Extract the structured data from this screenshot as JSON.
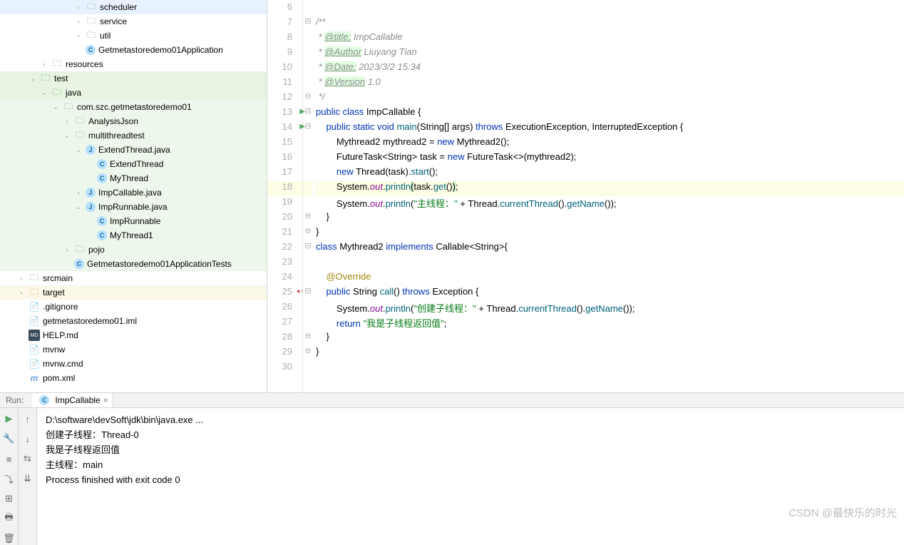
{
  "tree": {
    "scheduler": "scheduler",
    "service": "service",
    "util": "util",
    "app": "Getmetastoredemo01Application",
    "resources": "resources",
    "test": "test",
    "java": "java",
    "pkg": "com.szc.getmetastoredemo01",
    "analysisJson": "AnalysisJson",
    "multithreadtest": "multithreadtest",
    "extendThreadJava": "ExtendThread.java",
    "extendThread": "ExtendThread",
    "myThread": "MyThread",
    "impCallableJava": "ImpCallable.java",
    "impRunnableJava": "ImpRunnable.java",
    "impRunnable": "ImpRunnable",
    "myThread1": "MyThread1",
    "pojo": "pojo",
    "appTests": "Getmetastoredemo01ApplicationTests",
    "srcmain": "srcmain",
    "target": "target",
    "gitignore": ".gitignore",
    "iml": "getmetastoredemo01.iml",
    "helpMd": "HELP.md",
    "mvnw": "mvnw",
    "mvnwCmd": "mvnw.cmd",
    "pomXml": "pom.xml"
  },
  "gutter": [
    "6",
    "7",
    "8",
    "9",
    "10",
    "11",
    "12",
    "13",
    "14",
    "15",
    "16",
    "17",
    "18",
    "19",
    "20",
    "21",
    "22",
    "23",
    "24",
    "25",
    "26",
    "27",
    "28",
    "29",
    "30"
  ],
  "code": {
    "l7": "/**",
    "l8a": " * ",
    "l8b": "@title:",
    "l8c": " ImpCallable",
    "l9a": " * ",
    "l9b": "@Author",
    "l9c": " Liuyang Tian",
    "l10a": " * ",
    "l10b": "@Date:",
    "l10c": " 2023/3/2 15:34",
    "l11a": " * ",
    "l11b": "@Version",
    "l11c": " 1.0",
    "l12": " */",
    "l13_pub": "public ",
    "l13_class": "class ",
    "l13_name": "ImpCallable {",
    "l14_pub": "public ",
    "l14_static": "static ",
    "l14_void": "void ",
    "l14_main": "main",
    "l14_args": "(String[] args) ",
    "l14_throws": "throws ",
    "l14_exc": "ExecutionException, InterruptedException {",
    "l15a": "Mythread2 mythread2 = ",
    "l15_new": "new ",
    "l15b": "Mythread2();",
    "l16a": "FutureTask<String> task = ",
    "l16_new": "new ",
    "l16b": "FutureTask<>(mythread2);",
    "l17_new": "new ",
    "l17a": "Thread(task).",
    "l17_start": "start",
    "l17b": "();",
    "l18a": "System.",
    "l18_out": "out",
    "l18b": ".",
    "l18_println": "println",
    "l18_lp": "(",
    "l18c": "task.",
    "l18_get": "get",
    "l18d": "()",
    "l18_rp": ")",
    "l18e": ";",
    "l19a": "System.",
    "l19_out": "out",
    "l19b": ".",
    "l19_println": "println",
    "l19c": "(",
    "l19_str": "\"主线程：\"",
    "l19d": " + Thread.",
    "l19_ct": "currentThread",
    "l19e": "().",
    "l19_gn": "getName",
    "l19f": "());",
    "l20": "}",
    "l21": "}",
    "l22_class": "class ",
    "l22_name": "Mythread2 ",
    "l22_impl": "implements ",
    "l22_call": "Callable<String>{",
    "l24": "@Override",
    "l25_pub": "public ",
    "l25_str": "String ",
    "l25_call": "call",
    "l25a": "() ",
    "l25_throws": "throws ",
    "l25b": "Exception {",
    "l26a": "System.",
    "l26_out": "out",
    "l26b": ".",
    "l26_println": "println",
    "l26c": "(",
    "l26_str": "\"创建子线程：\"",
    "l26d": " + Thread.",
    "l26_ct": "currentThread",
    "l26e": "().",
    "l26_gn": "getName",
    "l26f": "());",
    "l27_ret": "return ",
    "l27_str": "\"我是子线程返回值\"",
    "l27a": ";",
    "l28": "}",
    "l29": "}"
  },
  "run": {
    "headerLabel": "Run:",
    "tabName": "ImpCallable",
    "out1": "D:\\software\\devSoft\\jdk\\bin\\java.exe ...",
    "out2": "创建子线程：Thread-0",
    "out3": "我是子线程返回值",
    "out4": "主线程：main",
    "out5": "Process finished with exit code 0"
  },
  "watermark": "CSDN @最快乐的时光"
}
